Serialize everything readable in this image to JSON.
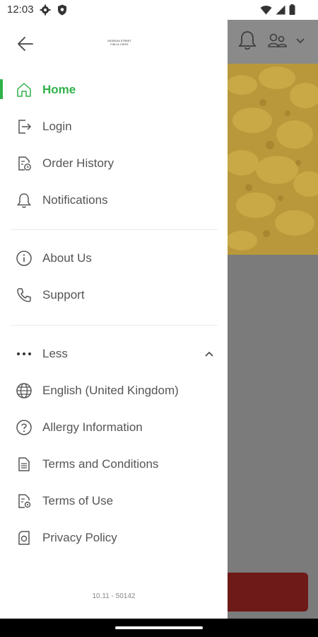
{
  "status_bar": {
    "time": "12:03",
    "left_icons": [
      "gear-icon",
      "shield-icon"
    ],
    "right_icons": [
      "wifi-icon",
      "signal-icon",
      "battery-icon"
    ]
  },
  "drawer": {
    "logo_text_line1": "GEORGIA STREET",
    "logo_text_line2": "FISH & CHIPS",
    "main_items": [
      {
        "label": "Home",
        "icon": "home-icon",
        "active": true
      },
      {
        "label": "Login",
        "icon": "login-icon",
        "active": false
      },
      {
        "label": "Order History",
        "icon": "order-history-icon",
        "active": false
      },
      {
        "label": "Notifications",
        "icon": "bell-icon",
        "active": false
      }
    ],
    "info_items": [
      {
        "label": "About Us",
        "icon": "info-icon"
      },
      {
        "label": "Support",
        "icon": "phone-icon"
      }
    ],
    "less_label": "Less",
    "extra_items": [
      {
        "label": "English (United Kingdom)",
        "icon": "globe-icon"
      },
      {
        "label": "Allergy Information",
        "icon": "question-icon"
      },
      {
        "label": "Terms and Conditions",
        "icon": "document-icon"
      },
      {
        "label": "Terms of Use",
        "icon": "document-settings-icon"
      },
      {
        "label": "Privacy Policy",
        "icon": "privacy-icon"
      }
    ],
    "version": "10.11 - 50142"
  },
  "colors": {
    "accent": "#2fb24a",
    "text": "#555555",
    "overlay": "#7b7b7b",
    "button": "#6e1a18"
  }
}
